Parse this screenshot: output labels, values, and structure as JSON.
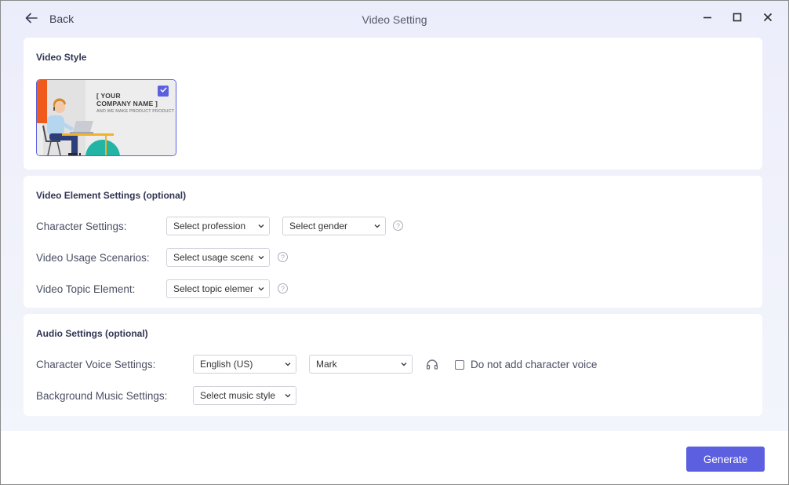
{
  "window": {
    "title": "Video Setting",
    "back_label": "Back"
  },
  "video_style": {
    "title": "Video Style",
    "thumbnail": {
      "heading_line1": "[ YOUR",
      "heading_line2": "COMPANY NAME ]",
      "tagline": "AND WE MAKE PRODUCT PRODUCT",
      "selected": true
    }
  },
  "element_settings": {
    "title": "Video Element Settings (optional)",
    "character_label": "Character Settings:",
    "profession_select": "Select profession",
    "gender_select": "Select gender",
    "usage_label": "Video Usage Scenarios:",
    "usage_select": "Select usage scenario",
    "topic_label": "Video Topic Element:",
    "topic_select": "Select topic element"
  },
  "audio_settings": {
    "title": "Audio Settings (optional)",
    "voice_label": "Character Voice Settings:",
    "language_select": "English (US)",
    "voice_select": "Mark",
    "no_voice_label": "Do not add character voice",
    "music_label": "Background Music Settings:",
    "music_select": "Select music style"
  },
  "footer": {
    "generate_label": "Generate"
  },
  "colors": {
    "accent": "#5b5fe0",
    "thumb_orange": "#f05a1a",
    "thumb_teal": "#22b5a6"
  },
  "icons": {
    "back": "arrow-left-icon",
    "minimize": "minimize-icon",
    "maximize": "maximize-icon",
    "close": "close-icon",
    "dropdown": "chevron-down-icon",
    "help": "help-icon",
    "preview_voice": "headphones-icon",
    "check": "check-icon"
  }
}
